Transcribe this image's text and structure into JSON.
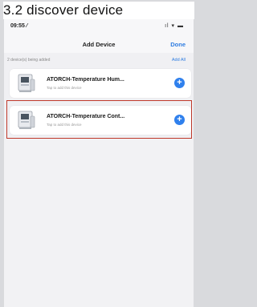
{
  "caption": "3.2 discover device",
  "status": {
    "time": "09:55 ⁄",
    "icons": "ıl ▾ ▬"
  },
  "nav": {
    "title": "Add Device",
    "done": "Done"
  },
  "subheader": {
    "count": "2 device(s) being added",
    "add_all": "Add All"
  },
  "devices": [
    {
      "name": "ATORCH-Temperature Hum...",
      "sub": "Tap to add this device"
    },
    {
      "name": "ATORCH-Temperature Cont...",
      "sub": "Tap to add this device"
    }
  ],
  "colors": {
    "accent": "#2f80ed",
    "highlight": "#c0392b"
  }
}
